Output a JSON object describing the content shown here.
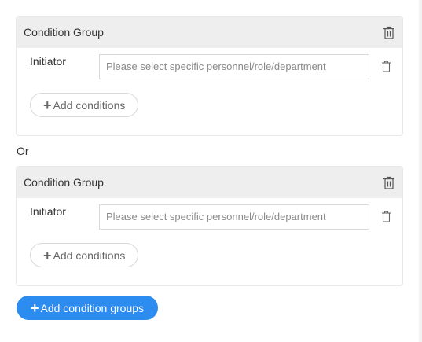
{
  "condition_groups": [
    {
      "title": "Condition Group",
      "rows": [
        {
          "label": "Initiator",
          "placeholder": "Please select specific personnel/role/department"
        }
      ],
      "add_conditions_label": "Add conditions"
    },
    {
      "title": "Condition Group",
      "rows": [
        {
          "label": "Initiator",
          "placeholder": "Please select specific personnel/role/department"
        }
      ],
      "add_conditions_label": "Add conditions"
    }
  ],
  "separator_label": "Or",
  "add_group_label": "Add condition groups",
  "icons": {
    "group_delete": "trash-icon",
    "row_delete": "trash-icon",
    "add": "plus-icon"
  },
  "colors": {
    "primary": "#2d8cf0",
    "header_bg": "#eeeeee",
    "border": "#d9d9d9"
  }
}
